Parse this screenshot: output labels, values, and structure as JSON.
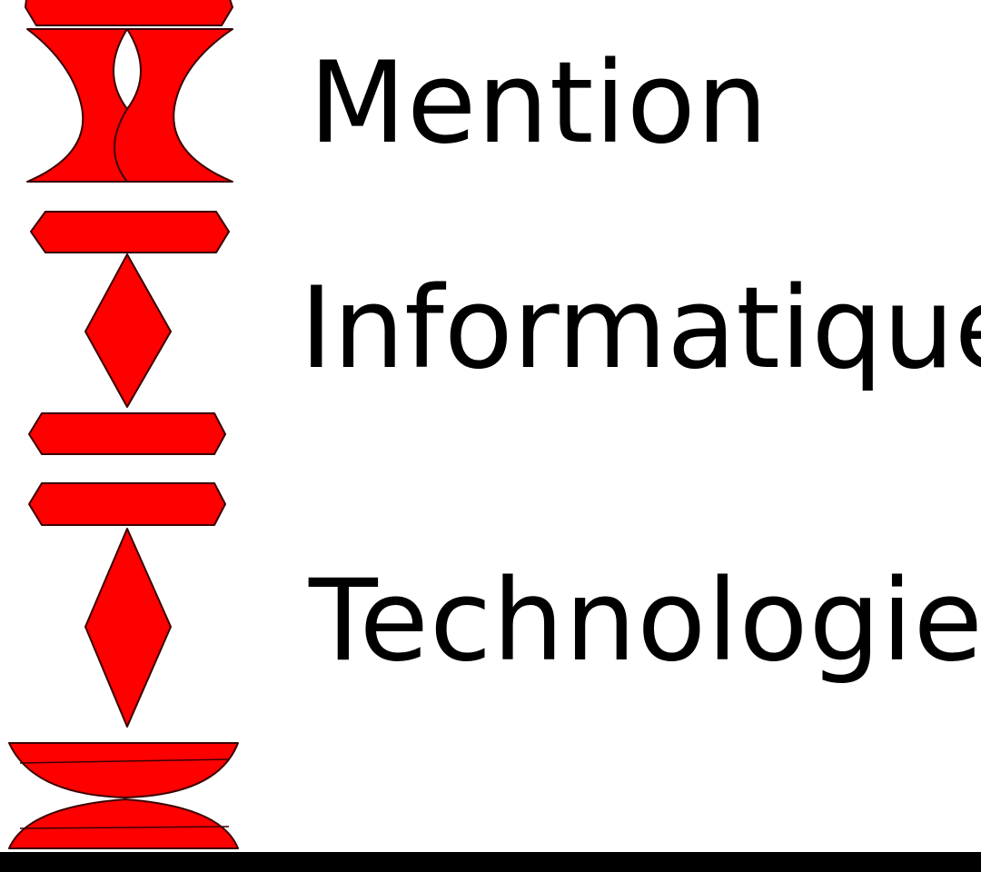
{
  "logo": {
    "icon": "red-totem-emblem",
    "fill_color": "#ff0000",
    "outline_color": "#3a0000"
  },
  "title_lines": [
    "Mention",
    "Informatique",
    "Technologie"
  ],
  "text_color": "#000000",
  "background_color": "#ffffff",
  "bottom_bar_color": "#000000"
}
